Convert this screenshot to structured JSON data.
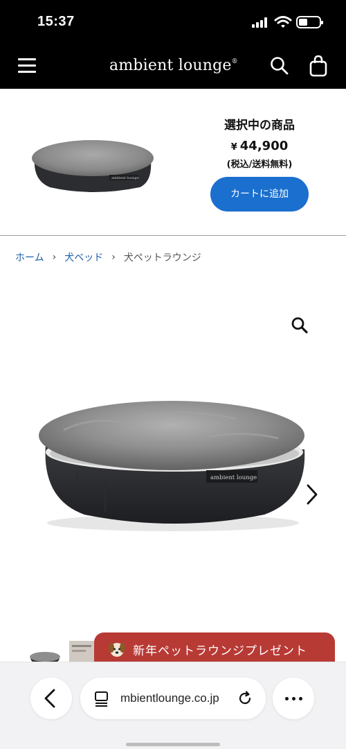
{
  "status_bar": {
    "time": "15:37"
  },
  "header": {
    "brand": "ambient lounge",
    "brand_mark": "®",
    "icons": [
      "menu-icon",
      "search-icon",
      "shopping-bag-icon"
    ]
  },
  "selected_product": {
    "title": "選択中の商品",
    "currency": "¥",
    "price": "44,900",
    "tax_note": "(税込/送料無料)",
    "cart_button": "カートに追加",
    "bed_label": "ambient lounge"
  },
  "breadcrumb": {
    "items": [
      {
        "label": "ホーム"
      },
      {
        "label": "犬ベッド"
      },
      {
        "label": "犬ペットラウンジ"
      }
    ],
    "separator": "›"
  },
  "product_image": {
    "bed_label": "ambient lounge",
    "icons": [
      "zoom-icon",
      "chevron-right-icon"
    ]
  },
  "promo_banner": {
    "text": "新年ペットラウンジプレゼント",
    "icon": "dog-icon"
  },
  "browser": {
    "url": "mbientlounge.co.jp",
    "icons": [
      "back-icon",
      "tabs-icon",
      "reload-icon",
      "more-icon"
    ]
  },
  "colors": {
    "header_bg": "#000000",
    "cart_button": "#1a6fcf",
    "breadcrumb_link": "#1d5fa8",
    "promo_bg": "#b83a35",
    "browser_bar": "#f2f2f4"
  }
}
